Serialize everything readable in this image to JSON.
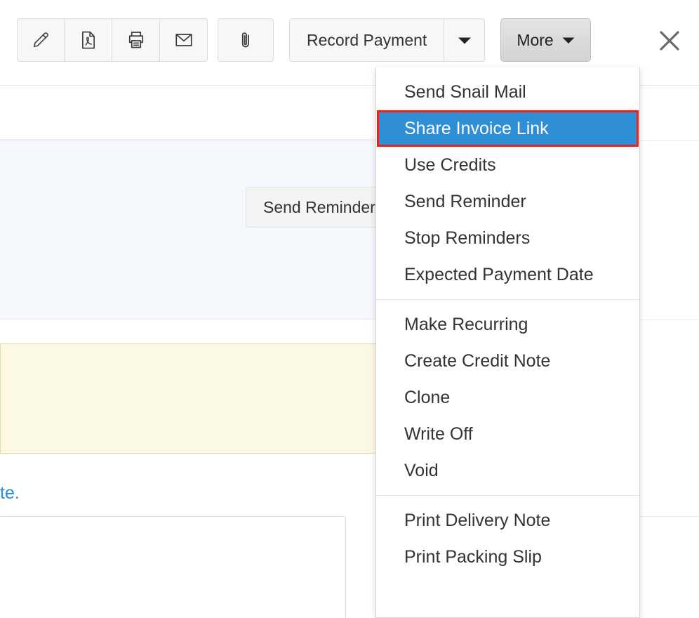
{
  "toolbar": {
    "icon_buttons": [
      {
        "name": "edit-icon",
        "title": "Edit"
      },
      {
        "name": "pdf-icon",
        "title": "PDF"
      },
      {
        "name": "print-icon",
        "title": "Print"
      },
      {
        "name": "email-icon",
        "title": "Email"
      }
    ],
    "attach_button": {
      "name": "attachment-icon",
      "title": "Attach File"
    },
    "record_payment_label": "Record Payment",
    "record_payment_caret": "caret-down-icon",
    "more_label": "More",
    "more_caret": "caret-down-icon",
    "close_label": "close-icon"
  },
  "banner": {
    "send_reminder_label": "Send Reminder",
    "overflow_icon": "kebab-menu-icon",
    "background_color": "#f5f8fd"
  },
  "notice": {
    "background_color": "#fbf8e3",
    "border_color": "#e4dba6"
  },
  "link": {
    "text": "te."
  },
  "menu": {
    "selected_index": 1,
    "selected_highlight_color": "#2e8ed6",
    "selected_outline_color": "#fb1c14",
    "sections": [
      {
        "items": [
          "Send Snail Mail",
          "Share Invoice Link",
          "Use Credits",
          "Send Reminder",
          "Stop Reminders",
          "Expected Payment Date"
        ]
      },
      {
        "items": [
          "Make Recurring",
          "Create Credit Note",
          "Clone",
          "Write Off",
          "Void"
        ]
      },
      {
        "items": [
          "Print Delivery Note",
          "Print Packing Slip"
        ]
      }
    ]
  }
}
